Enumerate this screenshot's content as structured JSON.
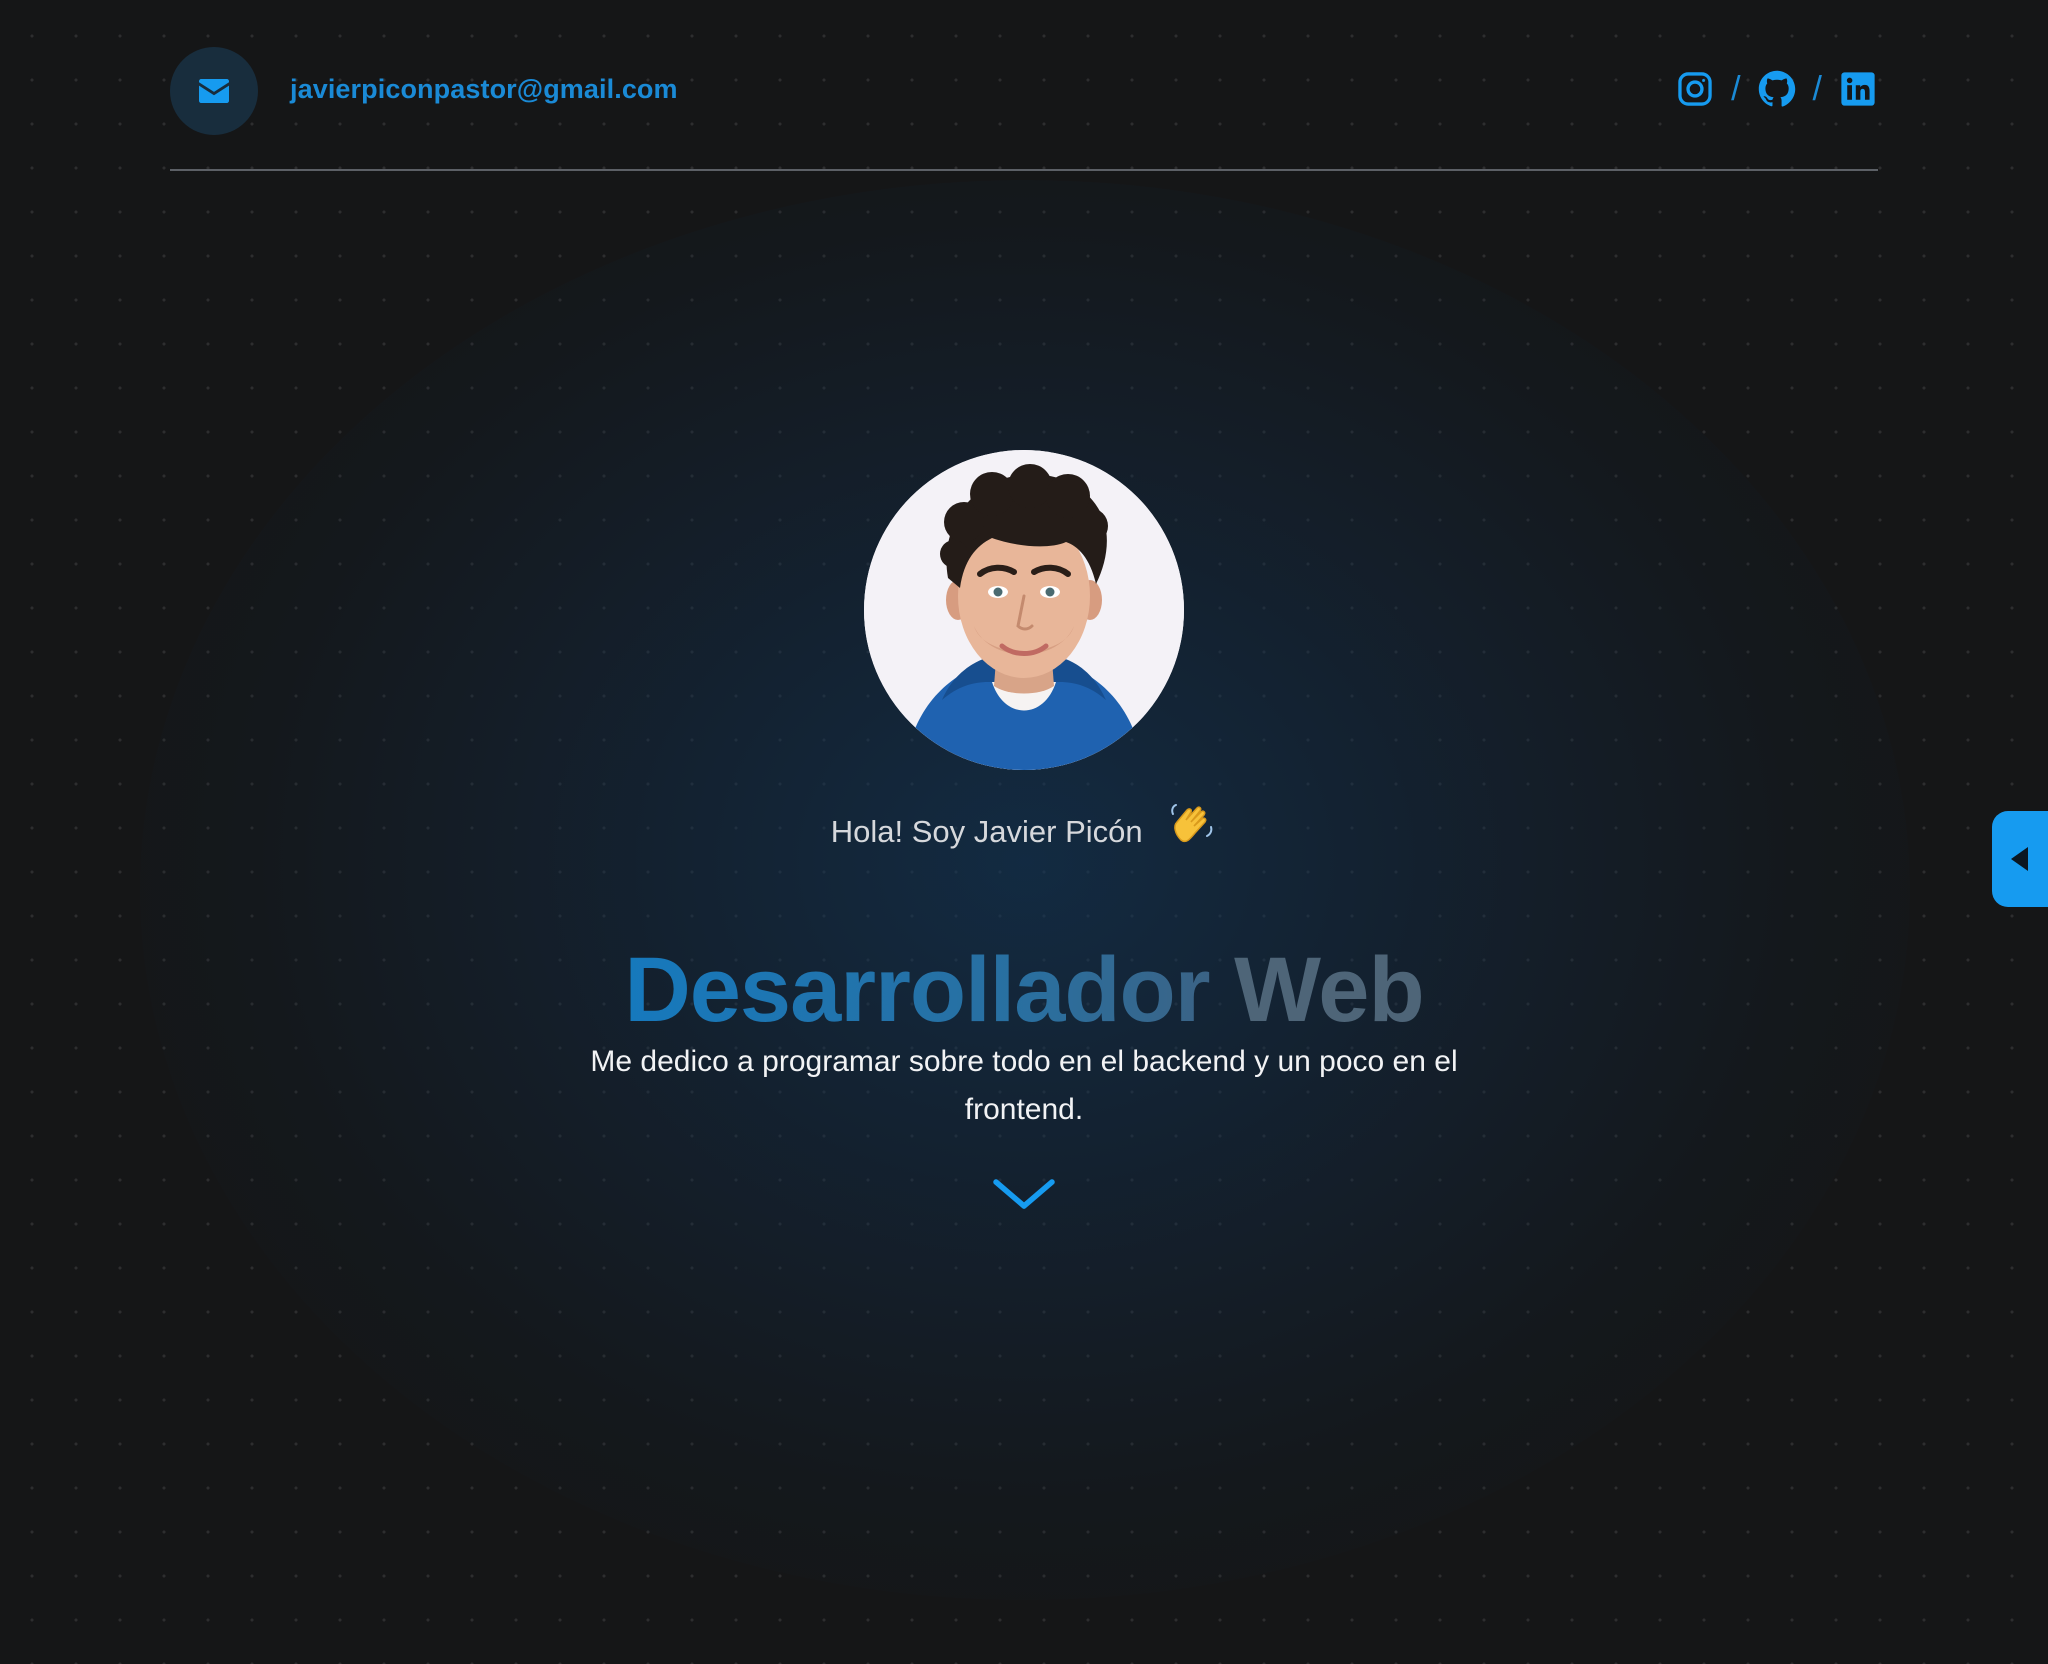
{
  "header": {
    "email": "javierpiconpastor@gmail.com",
    "mail_icon": "envelope-icon",
    "socials": [
      {
        "name": "Instagram",
        "icon": "instagram-icon"
      },
      {
        "name": "GitHub",
        "icon": "github-icon"
      },
      {
        "name": "LinkedIn",
        "icon": "linkedin-icon"
      }
    ],
    "separator": "/"
  },
  "hero": {
    "avatar_icon": "profile-photo",
    "greeting": "Hola! Soy Javier Picón",
    "greeting_emoji": "waving-hand-icon",
    "title_part1": "Desarrollador",
    "title_part2": "Web",
    "description": "Me dedico a programar sobre todo en el backend y un poco en el frontend.",
    "scroll_icon": "chevron-down-icon"
  },
  "side_panel": {
    "toggle_icon": "caret-left-icon"
  },
  "colors": {
    "background": "#151617",
    "accent": "#1a8ad6",
    "accent_bright": "#169bf0",
    "title_blue": "#1679bd",
    "title_gray": "#4e6578",
    "text": "#f2f3f5",
    "divider": "#5c6066"
  }
}
